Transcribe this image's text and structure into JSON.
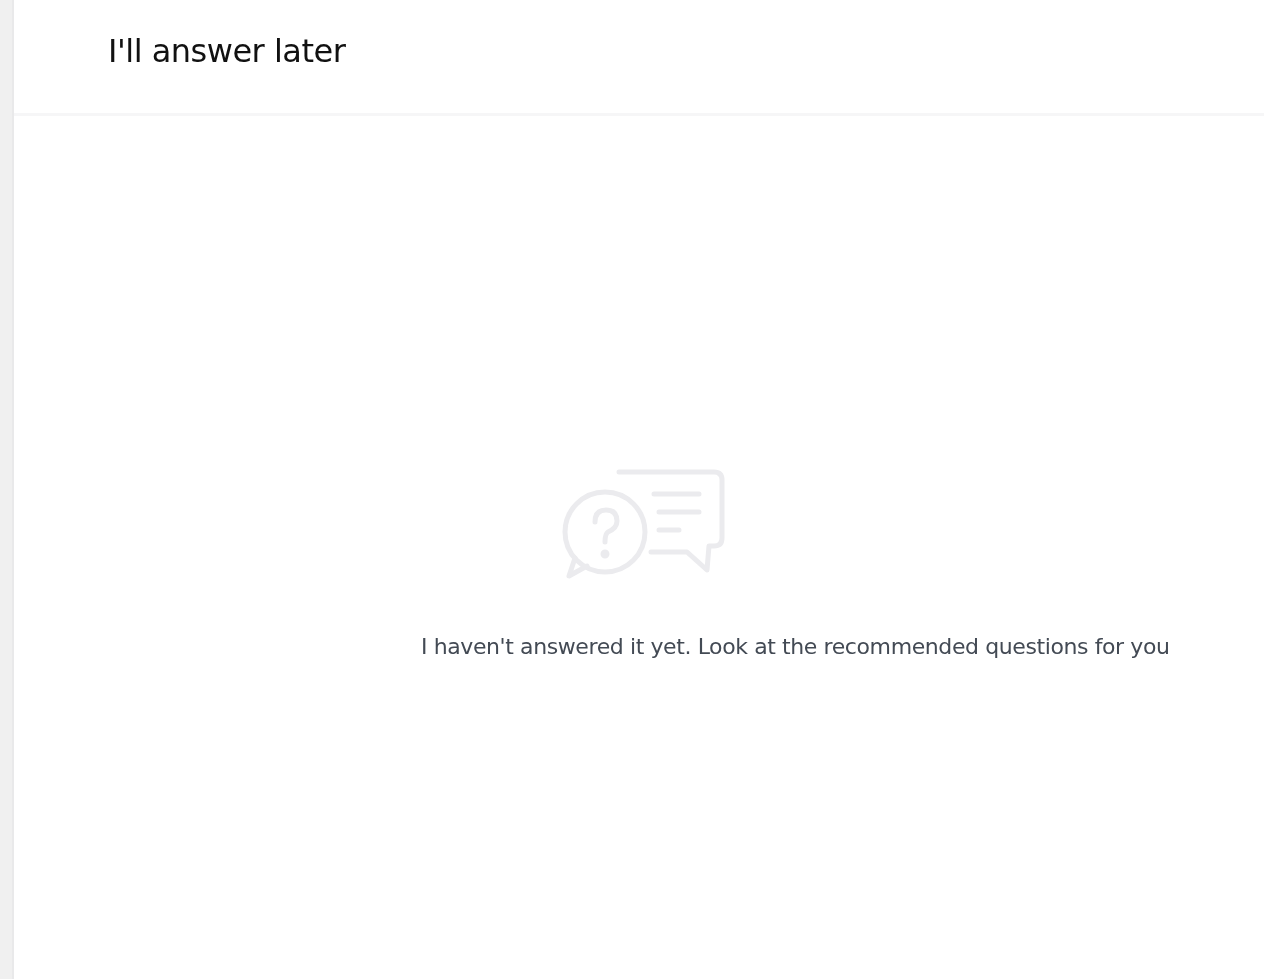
{
  "header": {
    "title": "I'll answer later"
  },
  "empty_state": {
    "message": "I haven't answered it yet. Look at the recommended questions for you"
  }
}
